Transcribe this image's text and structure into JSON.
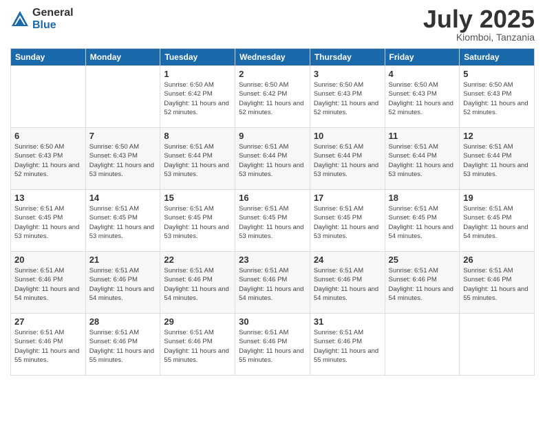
{
  "logo": {
    "general": "General",
    "blue": "Blue"
  },
  "title": "July 2025",
  "location": "Kiomboi, Tanzania",
  "days_header": [
    "Sunday",
    "Monday",
    "Tuesday",
    "Wednesday",
    "Thursday",
    "Friday",
    "Saturday"
  ],
  "weeks": [
    [
      {
        "day": "",
        "info": ""
      },
      {
        "day": "",
        "info": ""
      },
      {
        "day": "1",
        "info": "Sunrise: 6:50 AM\nSunset: 6:42 PM\nDaylight: 11 hours and 52 minutes."
      },
      {
        "day": "2",
        "info": "Sunrise: 6:50 AM\nSunset: 6:42 PM\nDaylight: 11 hours and 52 minutes."
      },
      {
        "day": "3",
        "info": "Sunrise: 6:50 AM\nSunset: 6:43 PM\nDaylight: 11 hours and 52 minutes."
      },
      {
        "day": "4",
        "info": "Sunrise: 6:50 AM\nSunset: 6:43 PM\nDaylight: 11 hours and 52 minutes."
      },
      {
        "day": "5",
        "info": "Sunrise: 6:50 AM\nSunset: 6:43 PM\nDaylight: 11 hours and 52 minutes."
      }
    ],
    [
      {
        "day": "6",
        "info": "Sunrise: 6:50 AM\nSunset: 6:43 PM\nDaylight: 11 hours and 52 minutes."
      },
      {
        "day": "7",
        "info": "Sunrise: 6:50 AM\nSunset: 6:43 PM\nDaylight: 11 hours and 53 minutes."
      },
      {
        "day": "8",
        "info": "Sunrise: 6:51 AM\nSunset: 6:44 PM\nDaylight: 11 hours and 53 minutes."
      },
      {
        "day": "9",
        "info": "Sunrise: 6:51 AM\nSunset: 6:44 PM\nDaylight: 11 hours and 53 minutes."
      },
      {
        "day": "10",
        "info": "Sunrise: 6:51 AM\nSunset: 6:44 PM\nDaylight: 11 hours and 53 minutes."
      },
      {
        "day": "11",
        "info": "Sunrise: 6:51 AM\nSunset: 6:44 PM\nDaylight: 11 hours and 53 minutes."
      },
      {
        "day": "12",
        "info": "Sunrise: 6:51 AM\nSunset: 6:44 PM\nDaylight: 11 hours and 53 minutes."
      }
    ],
    [
      {
        "day": "13",
        "info": "Sunrise: 6:51 AM\nSunset: 6:45 PM\nDaylight: 11 hours and 53 minutes."
      },
      {
        "day": "14",
        "info": "Sunrise: 6:51 AM\nSunset: 6:45 PM\nDaylight: 11 hours and 53 minutes."
      },
      {
        "day": "15",
        "info": "Sunrise: 6:51 AM\nSunset: 6:45 PM\nDaylight: 11 hours and 53 minutes."
      },
      {
        "day": "16",
        "info": "Sunrise: 6:51 AM\nSunset: 6:45 PM\nDaylight: 11 hours and 53 minutes."
      },
      {
        "day": "17",
        "info": "Sunrise: 6:51 AM\nSunset: 6:45 PM\nDaylight: 11 hours and 53 minutes."
      },
      {
        "day": "18",
        "info": "Sunrise: 6:51 AM\nSunset: 6:45 PM\nDaylight: 11 hours and 54 minutes."
      },
      {
        "day": "19",
        "info": "Sunrise: 6:51 AM\nSunset: 6:45 PM\nDaylight: 11 hours and 54 minutes."
      }
    ],
    [
      {
        "day": "20",
        "info": "Sunrise: 6:51 AM\nSunset: 6:46 PM\nDaylight: 11 hours and 54 minutes."
      },
      {
        "day": "21",
        "info": "Sunrise: 6:51 AM\nSunset: 6:46 PM\nDaylight: 11 hours and 54 minutes."
      },
      {
        "day": "22",
        "info": "Sunrise: 6:51 AM\nSunset: 6:46 PM\nDaylight: 11 hours and 54 minutes."
      },
      {
        "day": "23",
        "info": "Sunrise: 6:51 AM\nSunset: 6:46 PM\nDaylight: 11 hours and 54 minutes."
      },
      {
        "day": "24",
        "info": "Sunrise: 6:51 AM\nSunset: 6:46 PM\nDaylight: 11 hours and 54 minutes."
      },
      {
        "day": "25",
        "info": "Sunrise: 6:51 AM\nSunset: 6:46 PM\nDaylight: 11 hours and 54 minutes."
      },
      {
        "day": "26",
        "info": "Sunrise: 6:51 AM\nSunset: 6:46 PM\nDaylight: 11 hours and 55 minutes."
      }
    ],
    [
      {
        "day": "27",
        "info": "Sunrise: 6:51 AM\nSunset: 6:46 PM\nDaylight: 11 hours and 55 minutes."
      },
      {
        "day": "28",
        "info": "Sunrise: 6:51 AM\nSunset: 6:46 PM\nDaylight: 11 hours and 55 minutes."
      },
      {
        "day": "29",
        "info": "Sunrise: 6:51 AM\nSunset: 6:46 PM\nDaylight: 11 hours and 55 minutes."
      },
      {
        "day": "30",
        "info": "Sunrise: 6:51 AM\nSunset: 6:46 PM\nDaylight: 11 hours and 55 minutes."
      },
      {
        "day": "31",
        "info": "Sunrise: 6:51 AM\nSunset: 6:46 PM\nDaylight: 11 hours and 55 minutes."
      },
      {
        "day": "",
        "info": ""
      },
      {
        "day": "",
        "info": ""
      }
    ]
  ]
}
